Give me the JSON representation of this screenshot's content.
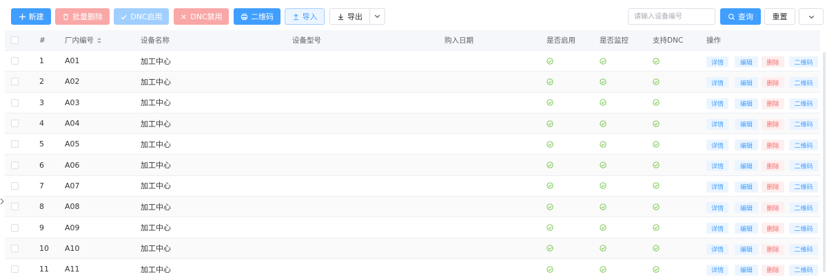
{
  "toolbar": {
    "new_label": "新建",
    "batch_delete_label": "批量删除",
    "dnc_enable_label": "DNC启用",
    "dnc_disable_label": "DNC禁用",
    "qrcode_label": "二维码",
    "import_label": "导入",
    "export_label": "导出",
    "search_placeholder": "请输入设备编号",
    "query_label": "查询",
    "reset_label": "重置"
  },
  "table": {
    "columns": {
      "num": "#",
      "code": "厂内编号",
      "name": "设备名称",
      "model": "设备型号",
      "date": "购入日期",
      "enabled": "是否启用",
      "monitor": "是否监控",
      "dnc": "支持DNC",
      "ops": "操作"
    },
    "op_labels": {
      "detail": "详情",
      "edit": "编辑",
      "delete": "删除",
      "qrcode": "二维码"
    },
    "rows": [
      {
        "num": "1",
        "code": "A01",
        "name": "加工中心",
        "model": "",
        "date": ""
      },
      {
        "num": "2",
        "code": "A02",
        "name": "加工中心",
        "model": "",
        "date": ""
      },
      {
        "num": "3",
        "code": "A03",
        "name": "加工中心",
        "model": "",
        "date": ""
      },
      {
        "num": "4",
        "code": "A04",
        "name": "加工中心",
        "model": "",
        "date": ""
      },
      {
        "num": "5",
        "code": "A05",
        "name": "加工中心",
        "model": "",
        "date": ""
      },
      {
        "num": "6",
        "code": "A06",
        "name": "加工中心",
        "model": "",
        "date": ""
      },
      {
        "num": "7",
        "code": "A07",
        "name": "加工中心",
        "model": "",
        "date": ""
      },
      {
        "num": "8",
        "code": "A08",
        "name": "加工中心",
        "model": "",
        "date": ""
      },
      {
        "num": "9",
        "code": "A09",
        "name": "加工中心",
        "model": "",
        "date": ""
      },
      {
        "num": "10",
        "code": "A10",
        "name": "加工中心",
        "model": "",
        "date": ""
      },
      {
        "num": "11",
        "code": "A11",
        "name": "加工中心",
        "model": "",
        "date": ""
      }
    ]
  },
  "colors": {
    "primary": "#409eff",
    "danger": "#f56c6c",
    "success": "#67c23a"
  }
}
